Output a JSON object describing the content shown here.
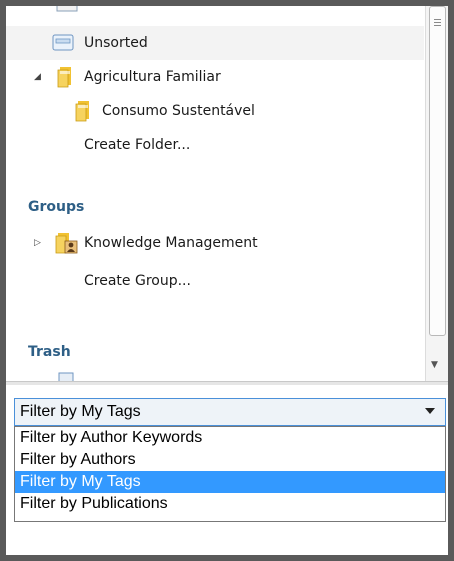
{
  "tree": {
    "items": [
      {
        "label": "Unsorted",
        "icon": "unsorted-tray-icon"
      },
      {
        "label": "Agricultura Familiar",
        "icon": "folder-icon"
      },
      {
        "label": "Consumo Sustentável",
        "icon": "folder-icon"
      },
      {
        "label": "Create Folder..."
      }
    ],
    "groups_heading": "Groups",
    "groups": [
      {
        "label": "Knowledge Management",
        "icon": "group-folder-icon"
      },
      {
        "label": "Create Group..."
      }
    ],
    "trash_heading": "Trash"
  },
  "filter": {
    "selected": "Filter by My Tags",
    "options": [
      "Filter by Author Keywords",
      "Filter by Authors",
      "Filter by My Tags",
      "Filter by Publications"
    ]
  },
  "colors": {
    "section": "#2e5f86",
    "highlight": "#3399ff",
    "focus_border": "#4a90d9"
  }
}
